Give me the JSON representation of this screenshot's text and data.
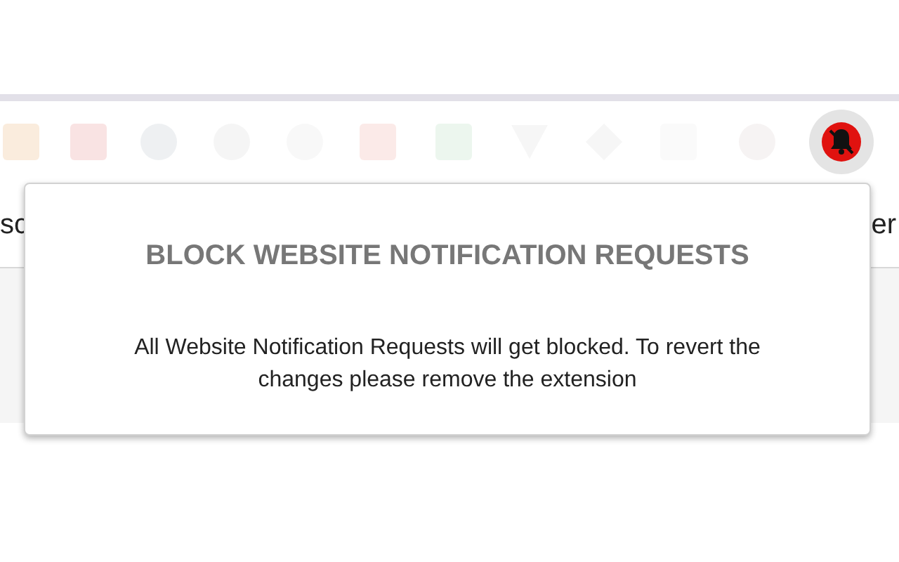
{
  "page": {
    "left_text": "sc",
    "right_text": "er"
  },
  "popup": {
    "title": "BLOCK WEBSITE NOTIFICATION REQUESTS",
    "message": "All Website Notification Requests will get blocked. To revert the changes please remove the extension"
  }
}
